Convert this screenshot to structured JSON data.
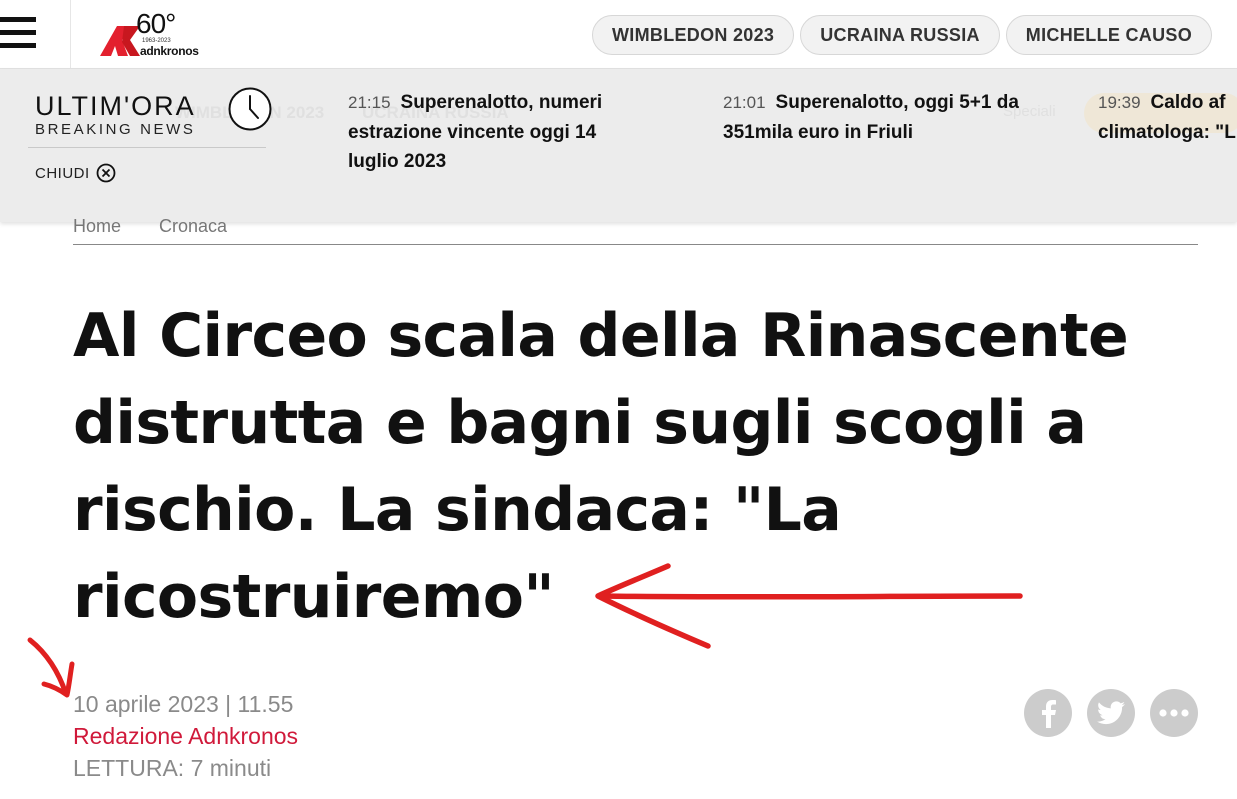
{
  "header": {
    "logo": {
      "anniversary": "60°",
      "years": "1963-2023",
      "brand": "adnkronos"
    },
    "topics": [
      "WIMBLEDON 2023",
      "UCRAINA RUSSIA",
      "MICHELLE CAUSO"
    ]
  },
  "breaking_news": {
    "title": "ULTIM'ORA",
    "subtitle": "BREAKING NEWS",
    "close_label": "CHIUDI",
    "background_hints": [
      "WIMBLEDON 2023",
      "UCRAINA RUSSIA",
      "Speciali"
    ],
    "items": [
      {
        "time": "21:15",
        "headline": "Superenalotto, numeri estrazione vincente oggi 14 luglio 2023"
      },
      {
        "time": "21:01",
        "headline": "Superenalotto, oggi 5+1 da 351mila euro in Friuli"
      },
      {
        "time": "19:39",
        "headline": "Caldo af climatologa: \"L"
      }
    ]
  },
  "breadcrumb": [
    "Home",
    "Cronaca"
  ],
  "article": {
    "title": "Al Circeo scala della Rinascente distrutta e bagni sugli scogli a rischio. La sindaca: \"La ricostruiremo\"",
    "date": "10 aprile 2023 | 11.55",
    "author": "Redazione Adnkronos",
    "reading_time": "LETTURA: 7 minuti"
  },
  "share_icons": [
    "facebook-icon",
    "twitter-icon",
    "more-icon"
  ],
  "colors": {
    "accent": "#d0193a",
    "logo_red": "#e3202e",
    "annotation_red": "#e02020",
    "panel_bg": "#ececec",
    "share_bg": "#cccccc"
  }
}
